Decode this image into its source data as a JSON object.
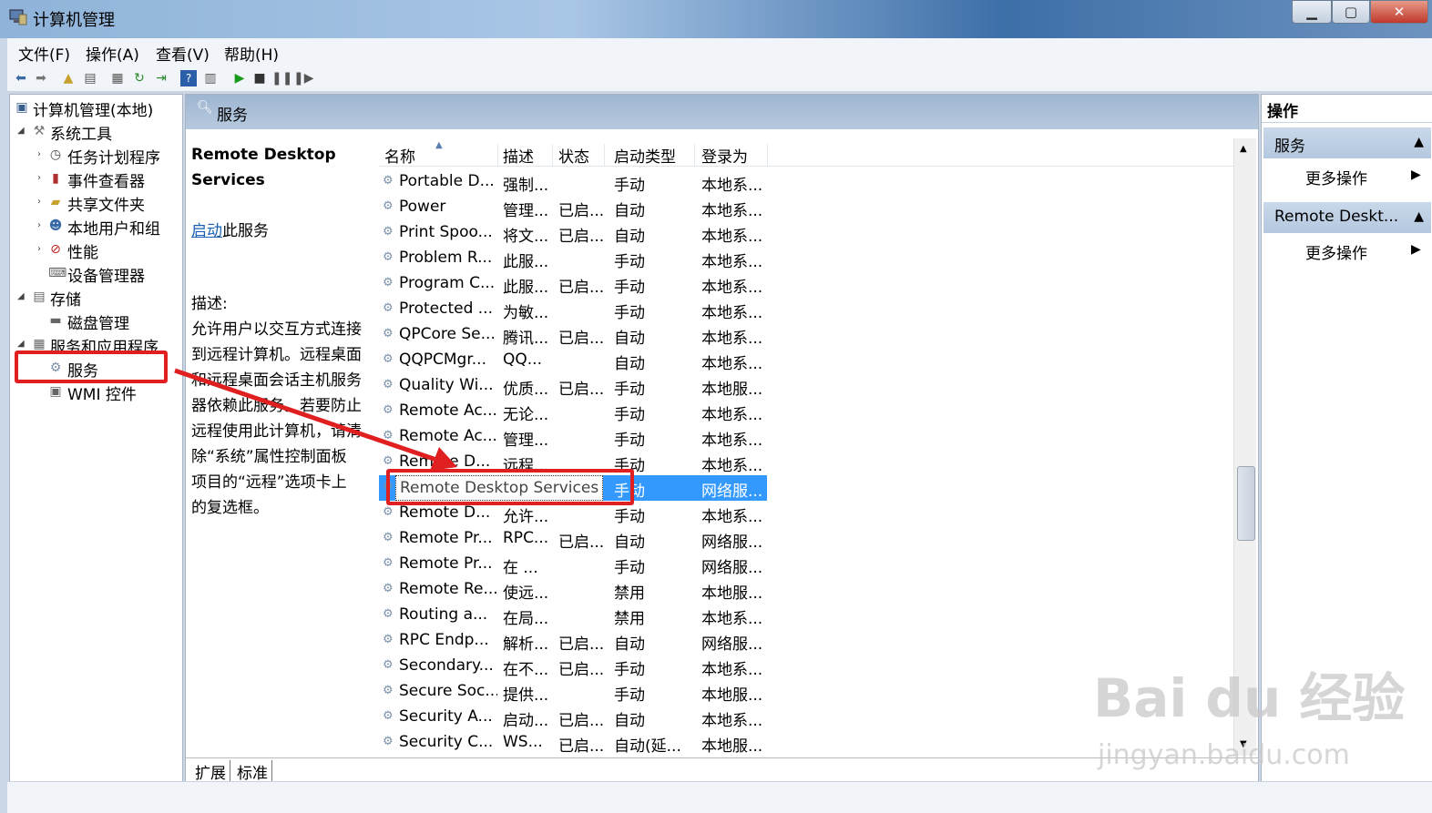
{
  "window": {
    "title": "计算机管理",
    "btn_min": "▁",
    "btn_max": "▢",
    "btn_close": "✕"
  },
  "menu": [
    "文件(F)",
    "操作(A)",
    "查看(V)",
    "帮助(H)"
  ],
  "tree": {
    "root": "计算机管理(本地)",
    "system_tools": "系统工具",
    "task_scheduler": "任务计划程序",
    "event_viewer": "事件查看器",
    "shared_folders": "共享文件夹",
    "local_users": "本地用户和组",
    "performance": "性能",
    "device_manager": "设备管理器",
    "storage": "存储",
    "disk_management": "磁盘管理",
    "services_apps": "服务和应用程序",
    "services": "服务",
    "wmi": "WMI 控件"
  },
  "center": {
    "header_title": "服务",
    "service_name_line1": "Remote Desktop",
    "service_name_line2": "Services",
    "start_link": "启动",
    "start_suffix": "此服务",
    "desc_label": "描述:",
    "desc_lines": [
      "允许用户以交互方式连接",
      "到远程计算机。远程桌面",
      "和远程桌面会话主机服务",
      "器依赖此服务。若要防止",
      "远程使用此计算机，请清",
      "除“系统”属性控制面板",
      "项目的“远程”选项卡上",
      "的复选框。"
    ]
  },
  "columns": [
    "名称",
    "描述",
    "状态",
    "启动类型",
    "登录为"
  ],
  "services": [
    {
      "name": "Portable D...",
      "desc": "强制...",
      "status": "",
      "startup": "手动",
      "logon": "本地系..."
    },
    {
      "name": "Power",
      "desc": "管理...",
      "status": "已启...",
      "startup": "自动",
      "logon": "本地系..."
    },
    {
      "name": "Print Spoo...",
      "desc": "将文...",
      "status": "已启...",
      "startup": "自动",
      "logon": "本地系..."
    },
    {
      "name": "Problem R...",
      "desc": "此服...",
      "status": "",
      "startup": "手动",
      "logon": "本地系..."
    },
    {
      "name": "Program C...",
      "desc": "此服...",
      "status": "已启...",
      "startup": "手动",
      "logon": "本地系..."
    },
    {
      "name": "Protected ...",
      "desc": "为敏...",
      "status": "",
      "startup": "手动",
      "logon": "本地系..."
    },
    {
      "name": "QPCore Se...",
      "desc": "腾讯...",
      "status": "已启...",
      "startup": "自动",
      "logon": "本地系..."
    },
    {
      "name": "QQPCMgr...",
      "desc": "QQ...",
      "status": "",
      "startup": "自动",
      "logon": "本地系..."
    },
    {
      "name": "Quality Wi...",
      "desc": "优质...",
      "status": "已启...",
      "startup": "手动",
      "logon": "本地服..."
    },
    {
      "name": "Remote Ac...",
      "desc": "无论...",
      "status": "",
      "startup": "手动",
      "logon": "本地系..."
    },
    {
      "name": "Remote Ac...",
      "desc": "管理...",
      "status": "",
      "startup": "手动",
      "logon": "本地系..."
    },
    {
      "name": "Remote D...",
      "desc": "远程...",
      "status": "",
      "startup": "手动",
      "logon": "本地系..."
    },
    {
      "name": "Remote Desktop Services",
      "desc": "",
      "status": "",
      "startup": "手动",
      "logon": "网络服..."
    },
    {
      "name": "Remote D...",
      "desc": "允许...",
      "status": "",
      "startup": "手动",
      "logon": "本地系..."
    },
    {
      "name": "Remote Pr...",
      "desc": "RPC...",
      "status": "已启...",
      "startup": "自动",
      "logon": "网络服..."
    },
    {
      "name": "Remote Pr...",
      "desc": "在 ...",
      "status": "",
      "startup": "手动",
      "logon": "网络服..."
    },
    {
      "name": "Remote Re...",
      "desc": "使远...",
      "status": "",
      "startup": "禁用",
      "logon": "本地服..."
    },
    {
      "name": "Routing a...",
      "desc": "在局...",
      "status": "",
      "startup": "禁用",
      "logon": "本地系..."
    },
    {
      "name": "RPC Endp...",
      "desc": "解析...",
      "status": "已启...",
      "startup": "自动",
      "logon": "网络服..."
    },
    {
      "name": "Secondary...",
      "desc": "在不...",
      "status": "已启...",
      "startup": "手动",
      "logon": "本地系..."
    },
    {
      "name": "Secure Soc...",
      "desc": "提供...",
      "status": "",
      "startup": "手动",
      "logon": "本地服..."
    },
    {
      "name": "Security A...",
      "desc": "启动...",
      "status": "已启...",
      "startup": "自动",
      "logon": "本地系..."
    },
    {
      "name": "Security C...",
      "desc": "WS...",
      "status": "已启...",
      "startup": "自动(延...",
      "logon": "本地服..."
    }
  ],
  "selected_index": 12,
  "tabs": [
    "扩展",
    "标准"
  ],
  "actions": {
    "title": "操作",
    "section1": "服务",
    "section1_more": "更多操作",
    "section2": "Remote Deskt...",
    "section2_more": "更多操作"
  },
  "watermark": {
    "line1": "Bai du 经验",
    "line2": "jingyan.baidu.com"
  },
  "colors": {
    "selection": "#3399ff",
    "annotation": "#e02020",
    "header": "#b7c9de"
  }
}
